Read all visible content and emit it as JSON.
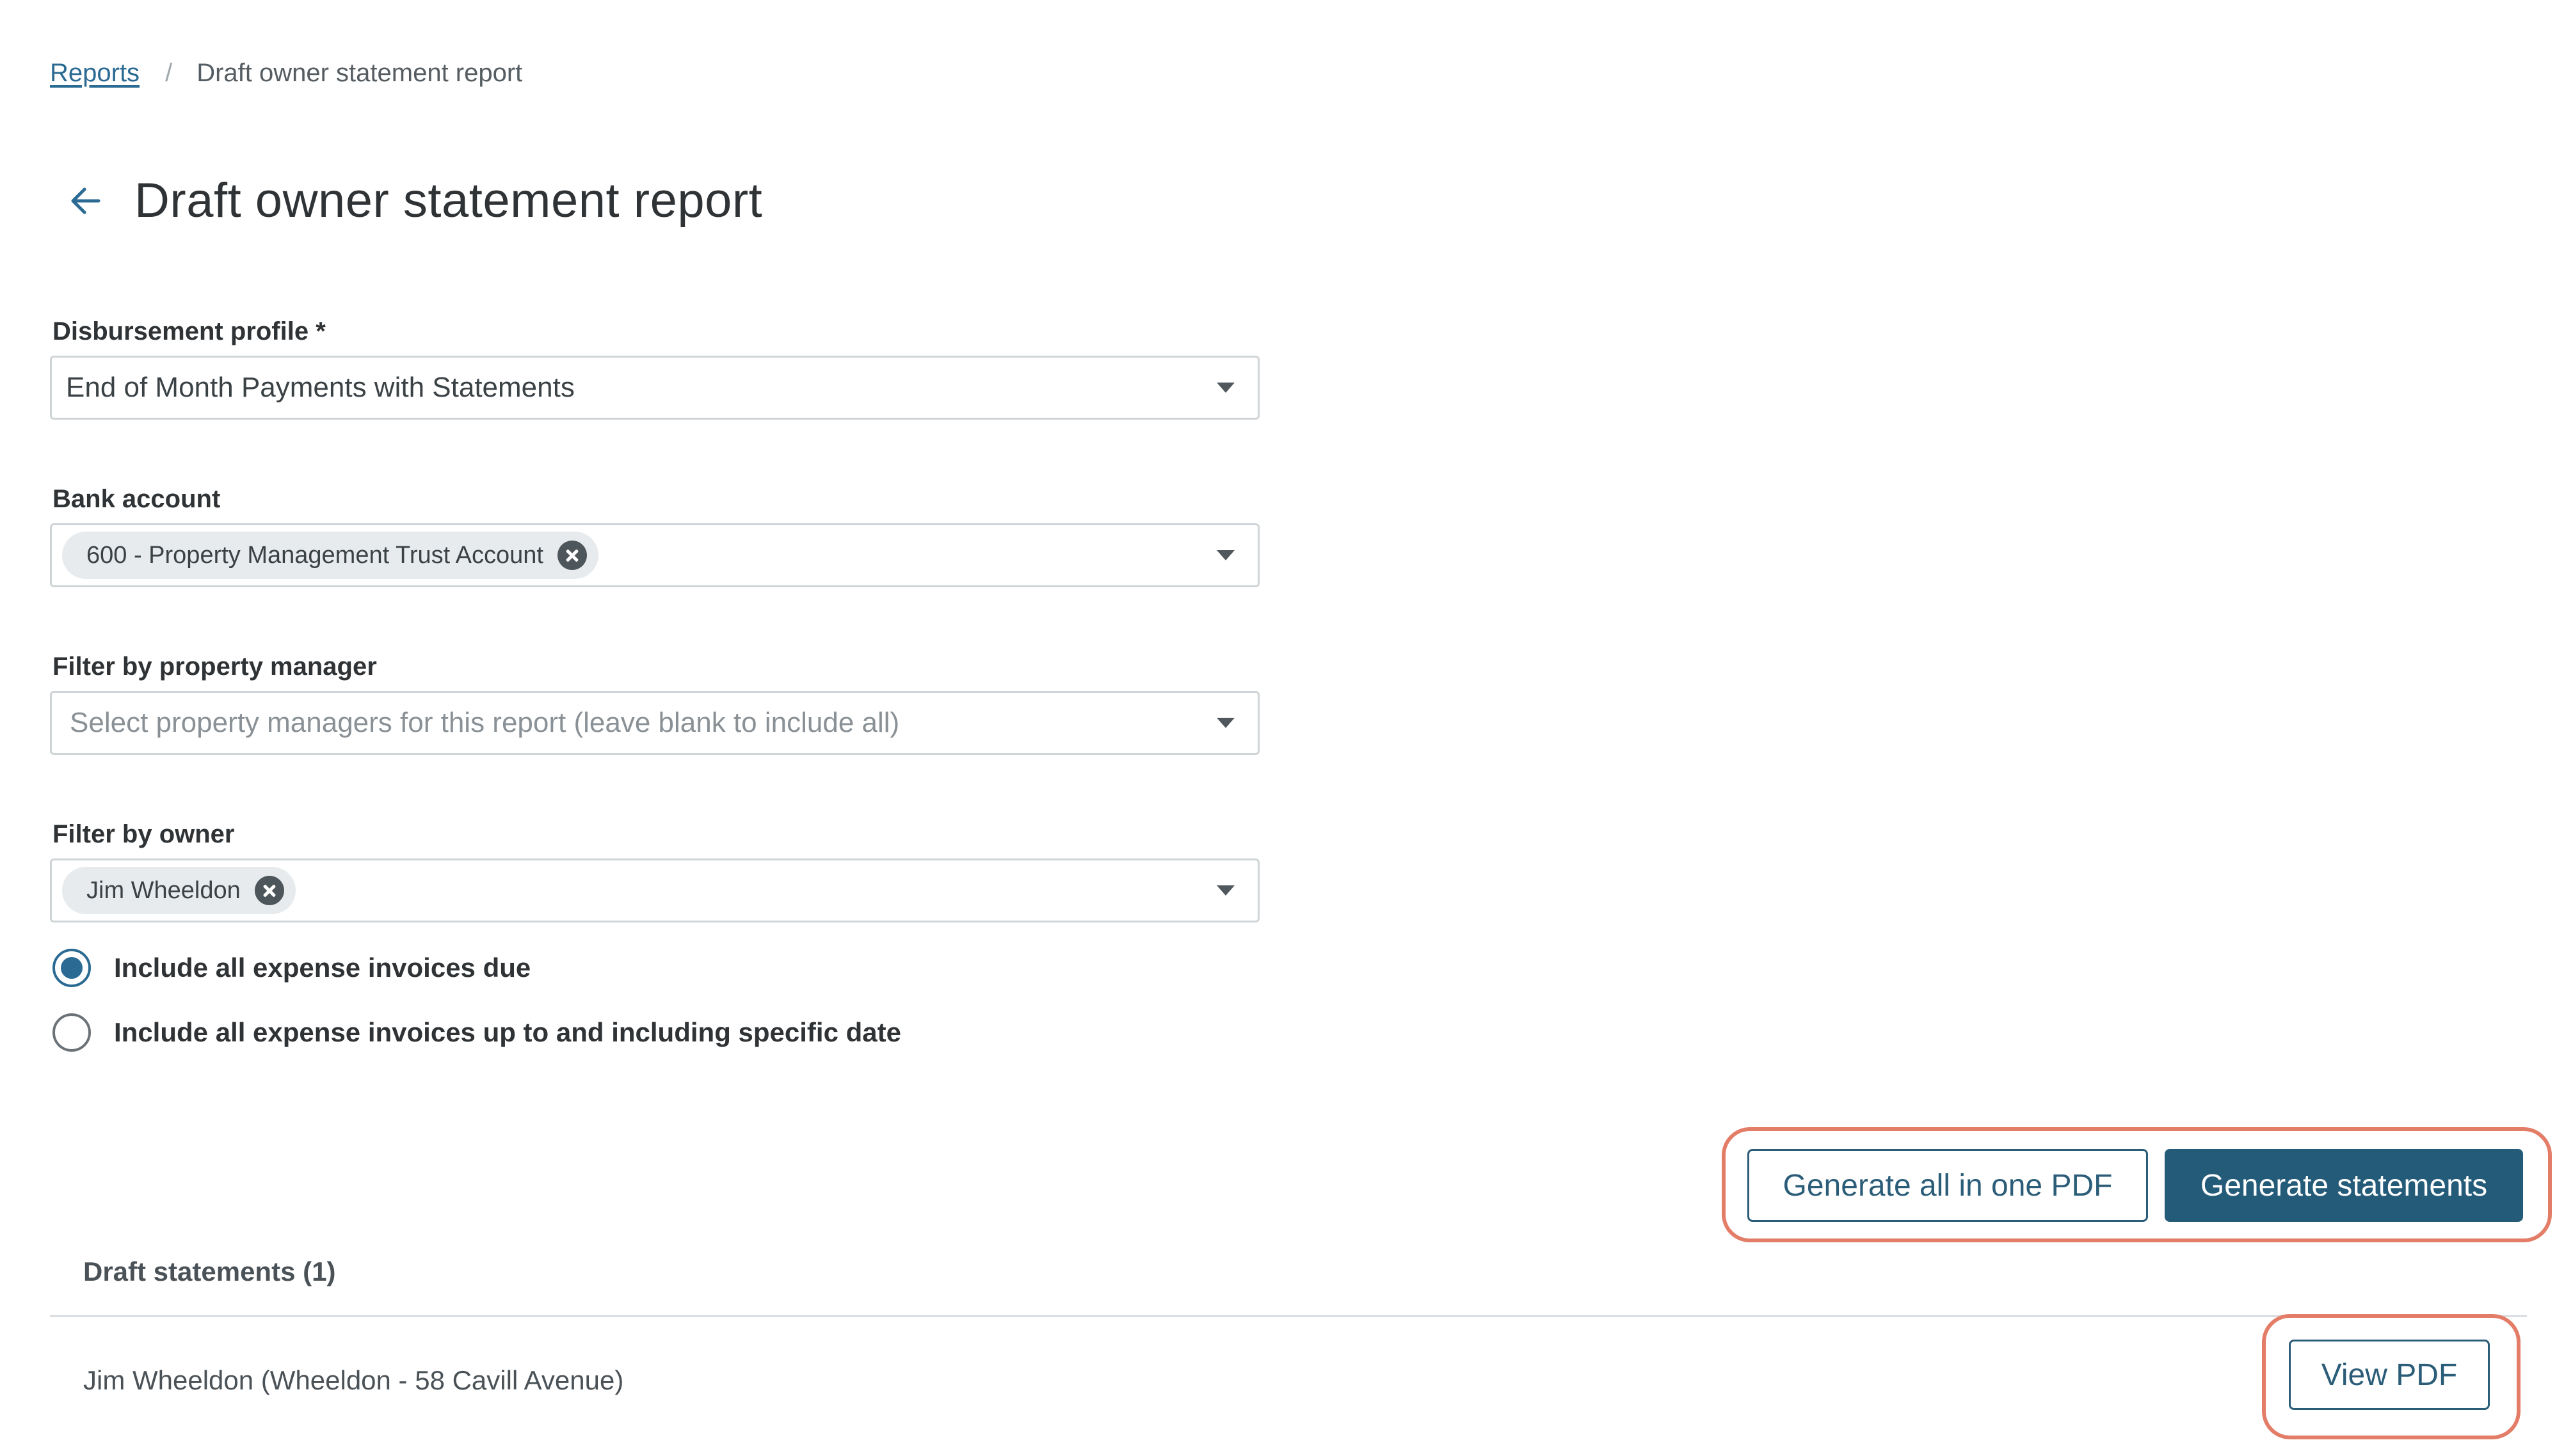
{
  "breadcrumb": {
    "parent": "Reports",
    "separator": "/",
    "current": "Draft owner statement report"
  },
  "page": {
    "title": "Draft owner statement report"
  },
  "form": {
    "disbursement_profile": {
      "label": "Disbursement profile *",
      "value": "End of Month Payments with Statements"
    },
    "bank_account": {
      "label": "Bank account",
      "chip": "600 - Property Management Trust Account"
    },
    "property_manager": {
      "label": "Filter by property manager",
      "placeholder": "Select property managers for this report (leave blank to include all)"
    },
    "owner": {
      "label": "Filter by owner",
      "chip": "Jim Wheeldon"
    },
    "radio_options": [
      {
        "label": "Include all expense invoices due",
        "checked": true
      },
      {
        "label": "Include all expense invoices up to and including specific date",
        "checked": false
      }
    ]
  },
  "actions": {
    "generate_pdf": "Generate all in one PDF",
    "generate_statements": "Generate statements"
  },
  "drafts": {
    "title": "Draft statements (1)",
    "rows": [
      {
        "text": "Jim Wheeldon (Wheeldon - 58 Cavill Avenue)",
        "action": "View PDF"
      }
    ]
  },
  "colors": {
    "accent": "#245b79",
    "link": "#2b6a93",
    "highlight": "#e37d68"
  }
}
